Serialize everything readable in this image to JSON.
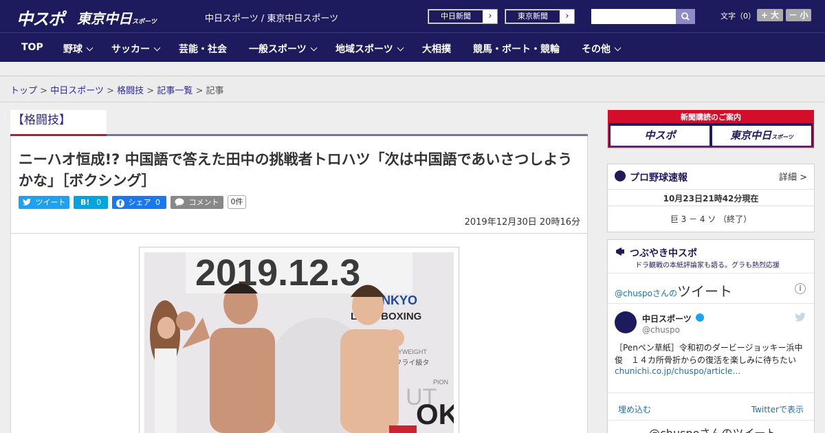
{
  "header": {
    "logo_chuspo": "中スポ",
    "logo_tokyo": "東京中日",
    "logo_tokyo_small": "スポーツ",
    "site_title": "中日スポーツ / 東京中日スポーツ",
    "paper_buttons": [
      "中日新聞",
      "東京新聞"
    ],
    "font_size_label": "文字（0）",
    "font_larger": "+ 大",
    "font_smaller": "－ 小"
  },
  "nav": {
    "items": [
      "TOP",
      "野球",
      "サッカー",
      "芸能・社会",
      "一般スポーツ",
      "地域スポーツ",
      "大相撲",
      "競馬・ボート・競輪",
      "その他"
    ]
  },
  "breadcrumb": {
    "links": [
      "トップ",
      "中日スポーツ",
      "格闘技",
      "記事一覧"
    ],
    "current": "記事",
    "sep": ">"
  },
  "article": {
    "category": "【格闘技】",
    "title": "ニーハオ恒成!? 中国語で答えた田中の挑戦者トロハツ「次は中国語であいさつしようかな」［ボクシング］",
    "share": {
      "tweet": "ツイート",
      "hatena": "B!",
      "hatena_count": "0",
      "facebook": "シェア",
      "facebook_count": "0",
      "comment": "コメント",
      "comment_count": "0件"
    },
    "date": "2019年12月30日 20時16分",
    "photo_text": {
      "banner_date": "2019.12.3",
      "sponsor": "NKYO",
      "event": "LI ME BOXING",
      "weight": "R FLYWEIGHT",
      "weight_jp": "ーフライ級タ",
      "champion": "PION",
      "banner_letters": "OK",
      "side_letters": "UT"
    },
    "colors": {
      "accent_red": "#d40d2b",
      "navy": "#1e1a5e"
    }
  },
  "sidebar": {
    "ad": {
      "title": "新聞購読のご案内",
      "logo1": "中スポ",
      "logo2": "東京中日",
      "logo2_small": "スポーツ"
    },
    "baseball": {
      "title": "プロ野球速報",
      "detail": "詳細 >",
      "timestamp": "10月23日21時42分現在",
      "score": "巨 3 － 4 ソ （終了）"
    },
    "tweets": {
      "title": "つぶやき中スポ",
      "subtitle": "ドラ観戦の本紙評論家も語る。グラも熱烈応援",
      "header_handle": "@chuspoさんの",
      "header_label": "ツイート",
      "account_name": "中日スポーツ",
      "account_handle": "@chuspo",
      "tweet_text": "［Penペン草紙］令和初のダービージョッキー浜中俊　１４カ所骨折からの復活を楽しみに待ちたい",
      "tweet_link": "chunichi.co.jp/chuspo/article…",
      "embed": "埋め込む",
      "view_on": "Twitterで表示",
      "footer": "@chuspoさんのツイート"
    }
  }
}
